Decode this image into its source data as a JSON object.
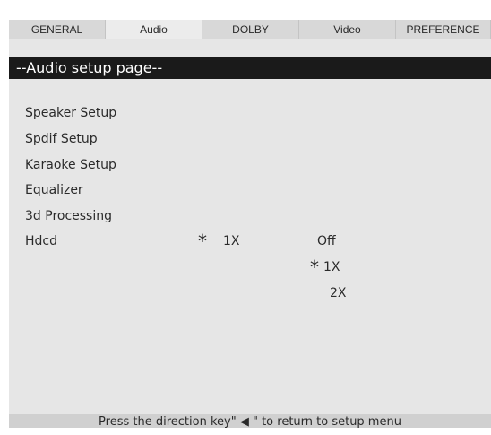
{
  "tabs": [
    {
      "label": "GENERAL"
    },
    {
      "label": "Audio"
    },
    {
      "label": "DOLBY"
    },
    {
      "label": "Video"
    },
    {
      "label": "PREFERENCE"
    }
  ],
  "page_title": "--Audio setup page--",
  "menu_items": [
    {
      "label": "Speaker Setup"
    },
    {
      "label": "Spdif Setup"
    },
    {
      "label": "Karaoke Setup"
    },
    {
      "label": "Equalizer"
    },
    {
      "label": "3d Processing"
    },
    {
      "label": "Hdcd"
    }
  ],
  "hdcd": {
    "current_marker": "*",
    "current_value": "1X",
    "options": [
      {
        "label": "Off",
        "marker": ""
      },
      {
        "label": "1X",
        "marker": "*"
      },
      {
        "label": "2X",
        "marker": ""
      }
    ]
  },
  "footer": {
    "hint": "Press the direction key\" ◀ \" to return to setup menu"
  },
  "colors": {
    "panel_background": "#e6e6e6",
    "header_background": "#1a1a1a",
    "header_text": "#ffffff",
    "text": "#2a2a2a"
  }
}
